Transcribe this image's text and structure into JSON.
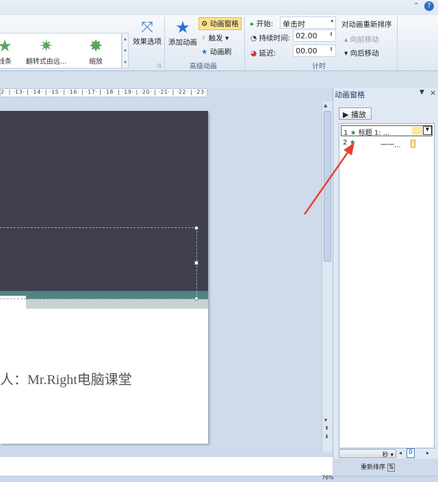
{
  "ribbon": {
    "gallery": [
      "线条",
      "翻转式由远...",
      "缩放"
    ],
    "effect_options": "效果选项",
    "add_animation": "添加动画",
    "animation_pane": "动画窗格",
    "trigger": "触发",
    "painter": "动画刷",
    "advanced_group": "高级动画",
    "start_label": "开始:",
    "start_value": "单击时",
    "duration_label": "持续时间:",
    "duration_value": "02.00",
    "delay_label": "延迟:",
    "delay_value": "00.00",
    "timing_group": "计时",
    "reorder": "对动画重新排序",
    "move_earlier": "向前移动",
    "move_later": "向后移动"
  },
  "ruler": "2· | ·13· | ·14· | ·15· | ·16· | ·17· | ·18· | ·19· | ·20· | ·21· | ·22· | ·23· | ·",
  "slide": {
    "subtitle": "人：Mr.Right电脑课堂"
  },
  "pane": {
    "title": "动画窗格",
    "play": "播放",
    "items": [
      {
        "num": "1",
        "label": "标题 1: ..."
      },
      {
        "num": "2",
        "label": "一一..."
      }
    ],
    "seconds": "秒",
    "zoom_value": "0",
    "reorder": "重新排序"
  },
  "status": {
    "zoom": "76%"
  },
  "colors": {
    "slide_dark": "#3f3f4f",
    "teal": "#4f8482",
    "arrow": "#e8412f"
  }
}
